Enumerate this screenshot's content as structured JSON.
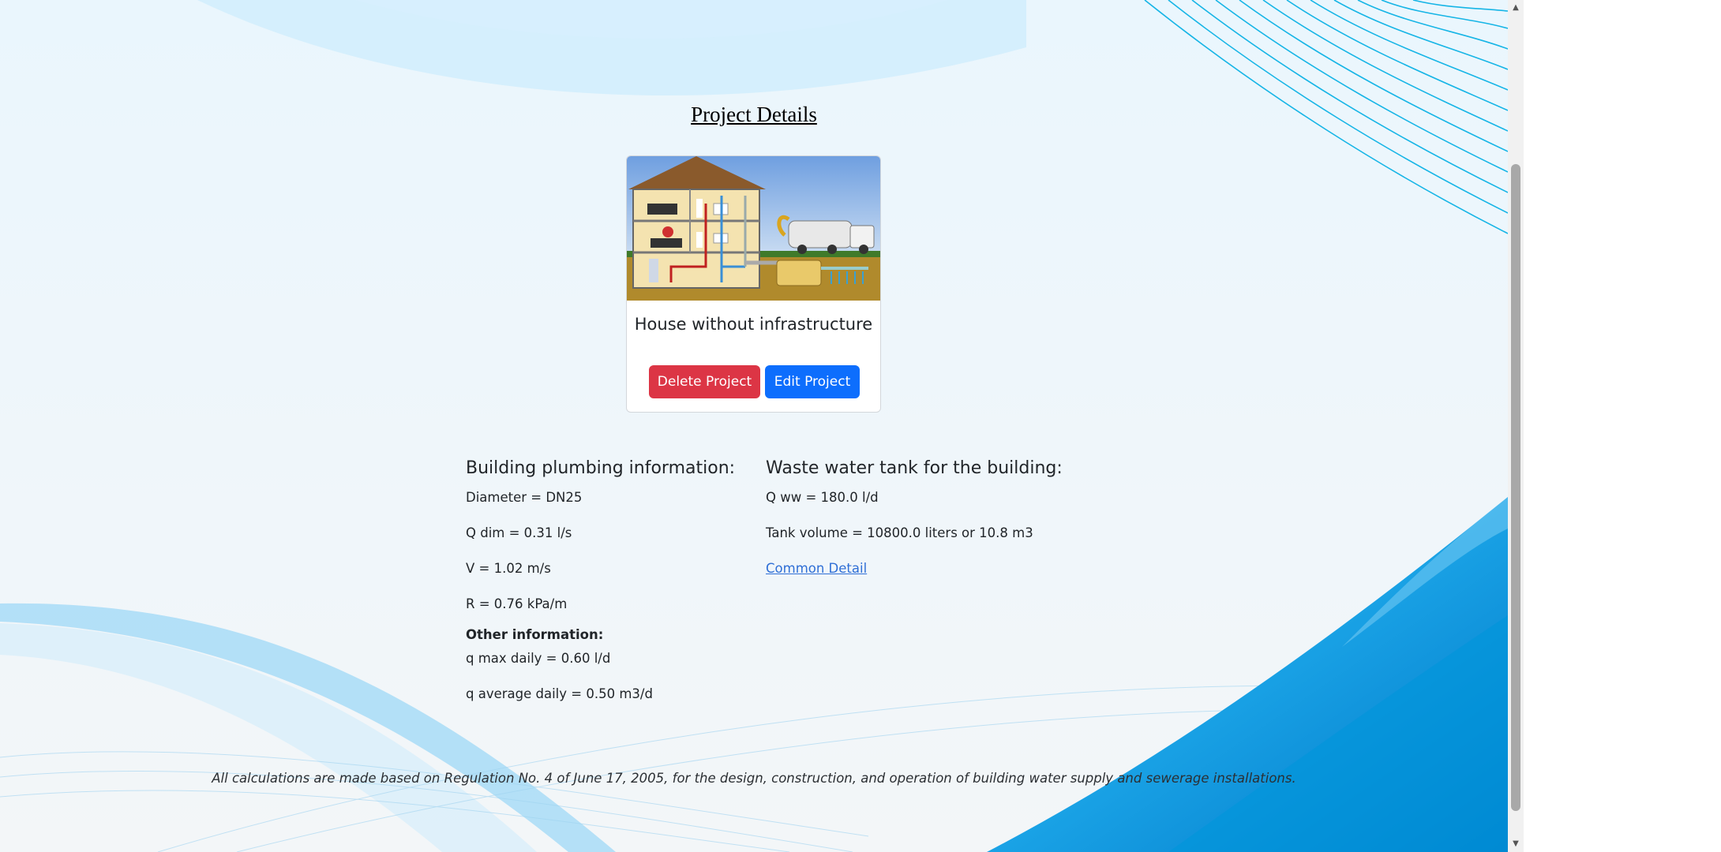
{
  "page": {
    "title": "Project Details"
  },
  "project": {
    "name": "House without infrastructure",
    "delete_label": "Delete Project",
    "edit_label": "Edit Project",
    "image_labels": {
      "rain_gutters": "Rain Gutters",
      "vacuum_truck": "Vacuum Truck",
      "water_heater": "Water Heater",
      "septic_tank": "Septic Tank",
      "filtration": "Filtration",
      "inlet": "Inlet / branch with perforated pipe"
    }
  },
  "plumbing": {
    "heading": "Building plumbing information:",
    "items": [
      "Diameter = DN25",
      "Q dim = 0.31 l/s",
      "V = 1.02 m/s",
      "R = 0.76 kPa/m"
    ],
    "other_heading": "Other information:",
    "other_items": [
      "q max daily = 0.60 l/d",
      "q average daily = 0.50 m3/d"
    ]
  },
  "tank": {
    "heading": "Waste water tank for the building:",
    "items": [
      "Q ww = 180.0 l/d",
      "Tank volume = 10800.0 liters or 10.8 m3"
    ],
    "link_label": "Common Detail"
  },
  "footer": {
    "note": "All calculations are made based on Regulation No. 4 of June 17, 2005, for the design, construction, and operation of building water supply and sewerage installations."
  },
  "colors": {
    "danger": "#dc3545",
    "primary": "#0d6efd",
    "link": "#2f6fd6",
    "wave_blue": "#0090d8"
  },
  "icons": {
    "scroll_up": "scroll-up-arrow-icon",
    "scroll_down": "scroll-down-arrow-icon"
  }
}
